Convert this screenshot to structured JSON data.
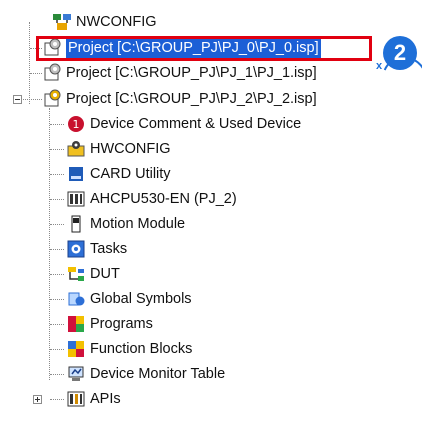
{
  "tree": {
    "nwconfig_root": "NWCONFIG",
    "projects": [
      {
        "label": "Project [C:\\GROUP_PJ\\PJ_0\\PJ_0.isp]"
      },
      {
        "label": "Project [C:\\GROUP_PJ\\PJ_1\\PJ_1.isp]"
      },
      {
        "label": "Project [C:\\GROUP_PJ\\PJ_2\\PJ_2.isp]"
      }
    ],
    "children": [
      {
        "label": "Device Comment & Used Device",
        "icon": "device-comment-icon"
      },
      {
        "label": "HWCONFIG",
        "icon": "hwconfig-icon"
      },
      {
        "label": "CARD Utility",
        "icon": "card-utility-icon"
      },
      {
        "label": "AHCPU530-EN  (PJ_2)",
        "icon": "cpu-module-icon"
      },
      {
        "label": "Motion Module",
        "icon": "motion-module-icon"
      },
      {
        "label": "Tasks",
        "icon": "tasks-icon"
      },
      {
        "label": "DUT",
        "icon": "dut-icon"
      },
      {
        "label": "Global Symbols",
        "icon": "global-symbols-icon"
      },
      {
        "label": "Programs",
        "icon": "programs-icon"
      },
      {
        "label": "Function Blocks",
        "icon": "function-blocks-icon"
      },
      {
        "label": "Device Monitor Table",
        "icon": "device-monitor-icon"
      },
      {
        "label": "APIs",
        "icon": "apis-icon"
      }
    ]
  },
  "callout": {
    "step": "2",
    "prefix": "x"
  },
  "colors": {
    "selection": "#1c5fd6",
    "highlight_box": "#e10010",
    "callout": "#1e6fd8"
  }
}
